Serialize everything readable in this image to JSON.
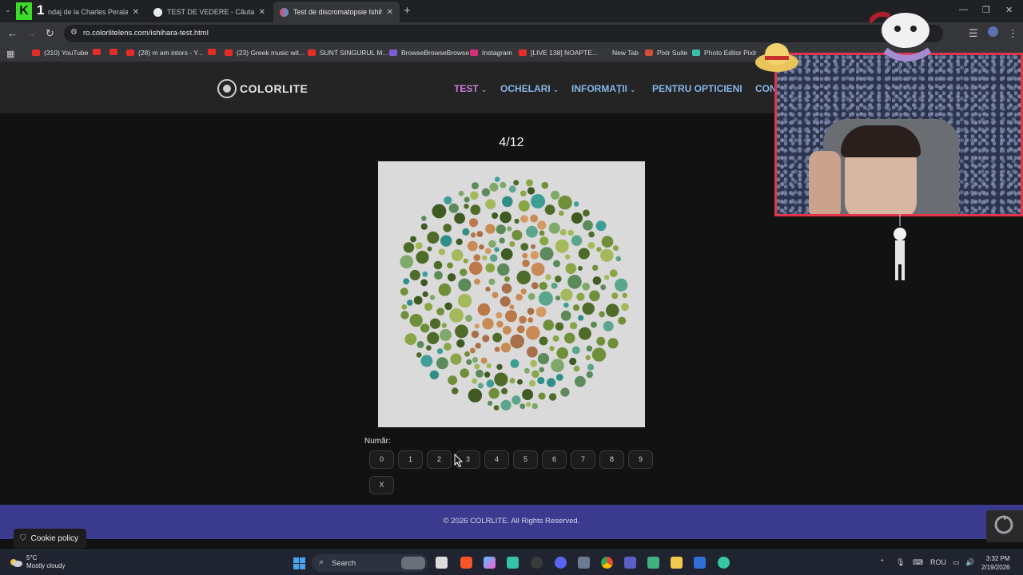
{
  "browser": {
    "stream_counter": "1",
    "tabs": [
      {
        "title": "ndaj de la Charles Perala - Yo",
        "active": false
      },
      {
        "title": "TEST DE VEDERE - Căutare Goo",
        "active": false
      },
      {
        "title": "Test de discromatopsie Ishihar",
        "active": true
      }
    ],
    "url": "ro.colorlitelens.com/ishihara-test.html",
    "bookmarks": [
      "(310) YouTube",
      "(28) m am intors - Y...",
      "(23) Greek music wit...",
      "SUNT SINGURUL M...",
      "BrowseBrowseBrowse",
      "Instagram",
      "[LIVE 138] NOAPTE...",
      "New Tab",
      "Pixlr Suite",
      "Photo Editor Pixlr"
    ]
  },
  "site": {
    "logo": "COLORLITE",
    "nav": [
      {
        "label": "TEST",
        "active": true,
        "dropdown": true
      },
      {
        "label": "OCHELARI",
        "active": false,
        "dropdown": true
      },
      {
        "label": "INFORMAȚII",
        "active": false,
        "dropdown": true
      },
      {
        "label": "PENTRU OPTICIENI",
        "active": false,
        "dropdown": false
      },
      {
        "label": "CON",
        "active": false,
        "dropdown": false
      }
    ]
  },
  "test": {
    "progress": "4/12",
    "current": 4,
    "total": 12,
    "answer_label": "Număr:",
    "digits": [
      "0",
      "1",
      "2",
      "3",
      "4",
      "5",
      "6",
      "7",
      "8",
      "9"
    ],
    "clear_label": "X"
  },
  "footer": {
    "text": "© 2026 COLRLITE. All Rights Reserved.",
    "cookie_label": "Cookie policy"
  },
  "taskbar": {
    "temperature": "5°C",
    "weather": "Mostly cloudy",
    "search_label": "Search",
    "language": "ROU",
    "time": "3:32 PM",
    "date": "2/19/2026"
  },
  "colors": {
    "nav_link": "#86b6e8",
    "nav_active": "#c77dd8",
    "footer_bg": "#3a3a8e",
    "plate_bg": "#dadada",
    "webcam_border": "#e3364a"
  }
}
